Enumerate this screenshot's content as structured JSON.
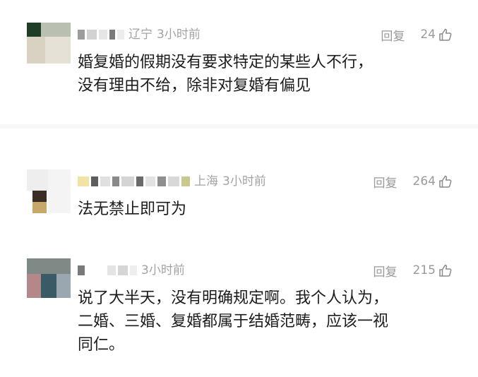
{
  "comments": [
    {
      "location": "辽宁",
      "time": "3小时前",
      "reply_label": "回复",
      "likes": "24",
      "text": "婚复婚的假期没有要求特定的某些人不行，\n没有理由不给，除非对复婚有偏见"
    },
    {
      "location": "上海",
      "time": "3小时前",
      "reply_label": "回复",
      "likes": "264",
      "text": "法无禁止即可为"
    },
    {
      "location": "",
      "time": "3小时前",
      "reply_label": "回复",
      "likes": "215",
      "text": "说了大半天，没有明确规定啊。我个人认为，\n二婚、三婚、复婚都属于结婚范畴，应该一视\n同仁。"
    }
  ],
  "colors": {
    "meta_text": "#a3a3a3",
    "body_text": "#1c1c1c",
    "divider": "#f7f7f7"
  },
  "icons": {
    "like": "thumbs-up-icon"
  }
}
